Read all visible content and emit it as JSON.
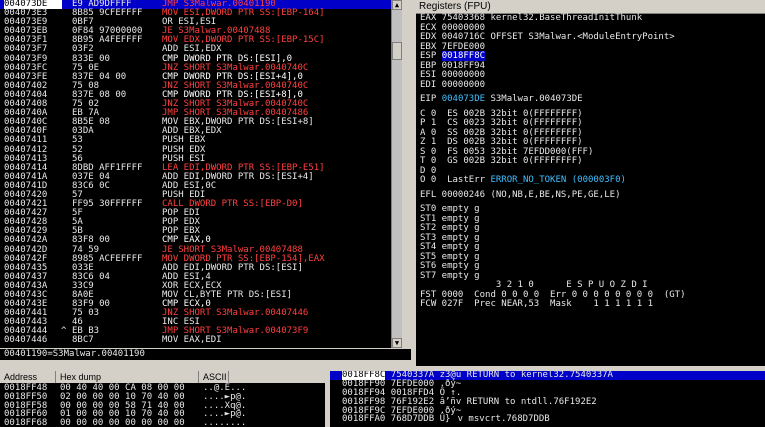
{
  "disasm": [
    {
      "addr": "004073DE",
      "mark": "",
      "hex": "E9 AD9DFFFF",
      "asm": "JMP S3Malwar.00401190",
      "cls": "op-jmp",
      "sel": true
    },
    {
      "addr": "004073E3",
      "mark": "",
      "hex": "8B85 9CFEFFFF",
      "asm": "MOV ESI,DWORD PTR SS:[EBP-164]",
      "cls": "op-jmp"
    },
    {
      "addr": "004073E9",
      "mark": "",
      "hex": "0BF7",
      "asm": "OR ESI,ESI",
      "cls": "op-normal"
    },
    {
      "addr": "004073EB",
      "mark": "",
      "hex": "0F84 97000000",
      "asm": "JE S3Malwar.00407488",
      "cls": "op-jmp"
    },
    {
      "addr": "004073F1",
      "mark": "",
      "hex": "8B95 A4FEFFFF",
      "asm": "MOV EDX,DWORD PTR SS:[EBP-15C]",
      "cls": "op-jmp"
    },
    {
      "addr": "004073F7",
      "mark": "",
      "hex": "03F2",
      "asm": "ADD ESI,EDX",
      "cls": "op-normal"
    },
    {
      "addr": "004073F9",
      "mark": "",
      "hex": "833E 00",
      "asm": "CMP DWORD PTR DS:[ESI],0",
      "cls": "op-cmp"
    },
    {
      "addr": "004073FC",
      "mark": "",
      "hex": "75 0E",
      "asm": "JNZ SHORT S3Malwar.0040740C",
      "cls": "op-jmp"
    },
    {
      "addr": "004073FE",
      "mark": "",
      "hex": "837E 04 00",
      "asm": "CMP DWORD PTR DS:[ESI+4],0",
      "cls": "op-cmp"
    },
    {
      "addr": "00407402",
      "mark": "",
      "hex": "75 08",
      "asm": "JNZ SHORT S3Malwar.0040740C",
      "cls": "op-jmp"
    },
    {
      "addr": "00407404",
      "mark": "",
      "hex": "837E 08 00",
      "asm": "CMP DWORD PTR DS:[ESI+8],0",
      "cls": "op-cmp"
    },
    {
      "addr": "00407408",
      "mark": "",
      "hex": "75 02",
      "asm": "JNZ SHORT S3Malwar.0040740C",
      "cls": "op-jmp"
    },
    {
      "addr": "0040740A",
      "mark": "",
      "hex": "EB 7A",
      "asm": "JMP SHORT S3Malwar.00407486",
      "cls": "op-jmp"
    },
    {
      "addr": "0040740C",
      "mark": "",
      "hex": "8B5E 08",
      "asm": "MOV EBX,DWORD PTR DS:[ESI+8]",
      "cls": "op-normal"
    },
    {
      "addr": "0040740F",
      "mark": "",
      "hex": "03DA",
      "asm": "ADD EBX,EDX",
      "cls": "op-normal"
    },
    {
      "addr": "00407411",
      "mark": "",
      "hex": "53",
      "asm": "PUSH EBX",
      "cls": "op-normal"
    },
    {
      "addr": "00407412",
      "mark": "",
      "hex": "52",
      "asm": "PUSH EDX",
      "cls": "op-normal"
    },
    {
      "addr": "00407413",
      "mark": "",
      "hex": "56",
      "asm": "PUSH ESI",
      "cls": "op-normal"
    },
    {
      "addr": "00407414",
      "mark": "",
      "hex": "8DBD AFF1FFFF",
      "asm": "LEA EDI,DWORD PTR SS:[EBP-E51]",
      "cls": "op-jmp"
    },
    {
      "addr": "0040741A",
      "mark": "",
      "hex": "037E 04",
      "asm": "ADD EDI,DWORD PTR DS:[ESI+4]",
      "cls": "op-normal"
    },
    {
      "addr": "0040741D",
      "mark": "",
      "hex": "83C6 0C",
      "asm": "ADD ESI,0C",
      "cls": "op-normal"
    },
    {
      "addr": "00407420",
      "mark": "",
      "hex": "57",
      "asm": "PUSH EDI",
      "cls": "op-normal"
    },
    {
      "addr": "00407421",
      "mark": "",
      "hex": "FF95 30FFFFFF",
      "asm": "CALL DWORD PTR SS:[EBP-D0]",
      "cls": "op-jmp"
    },
    {
      "addr": "00407427",
      "mark": "",
      "hex": "5F",
      "asm": "POP EDI",
      "cls": "op-normal"
    },
    {
      "addr": "00407428",
      "mark": "",
      "hex": "5A",
      "asm": "POP EDX",
      "cls": "op-normal"
    },
    {
      "addr": "00407429",
      "mark": "",
      "hex": "5B",
      "asm": "POP EBX",
      "cls": "op-normal"
    },
    {
      "addr": "0040742A",
      "mark": "",
      "hex": "83F8 00",
      "asm": "CMP EAX,0",
      "cls": "op-cmp"
    },
    {
      "addr": "0040742D",
      "mark": "",
      "hex": "74 59",
      "asm": "JE SHORT S3Malwar.00407488",
      "cls": "op-jmp"
    },
    {
      "addr": "0040742F",
      "mark": "",
      "hex": "8985 ACFEFFFF",
      "asm": "MOV DWORD PTR SS:[EBP-154],EAX",
      "cls": "op-jmp"
    },
    {
      "addr": "00407435",
      "mark": "",
      "hex": "033E",
      "asm": "ADD EDI,DWORD PTR DS:[ESI]",
      "cls": "op-normal"
    },
    {
      "addr": "00407437",
      "mark": "",
      "hex": "83C6 04",
      "asm": "ADD ESI,4",
      "cls": "op-normal"
    },
    {
      "addr": "0040743A",
      "mark": "",
      "hex": "33C9",
      "asm": "XOR ECX,ECX",
      "cls": "op-normal"
    },
    {
      "addr": "0040743C",
      "mark": "",
      "hex": "8A0E",
      "asm": "MOV CL,BYTE PTR DS:[ESI]",
      "cls": "op-normal"
    },
    {
      "addr": "0040743E",
      "mark": "",
      "hex": "83F9 00",
      "asm": "CMP ECX,0",
      "cls": "op-cmp"
    },
    {
      "addr": "00407441",
      "mark": "",
      "hex": "75 03",
      "asm": "JNZ SHORT S3Malwar.00407446",
      "cls": "op-jmp"
    },
    {
      "addr": "00407443",
      "mark": "",
      "hex": "46",
      "asm": "INC ESI",
      "cls": "op-normal"
    },
    {
      "addr": "00407444",
      "mark": "^",
      "hex": "EB B3",
      "asm": "JMP SHORT S3Malwar.004073F9",
      "cls": "op-jmp"
    },
    {
      "addr": "00407446",
      "mark": "",
      "hex": "8BC7",
      "asm": "MOV EAX,EDI",
      "cls": "op-normal"
    }
  ],
  "info_line": "00401190=S3Malwar.00401190",
  "registers": {
    "title": "Registers (FPU)",
    "lines": [
      "EAX 75403368 kernel32.BaseThreadInitThunk",
      "ECX 00000000",
      "EDX 0040716C OFFSET S3Malwar.<ModuleEntryPoint>",
      "EBX 7EFDE000",
      "ESP 0018FF8C",
      "EBP 0018FF94",
      "ESI 00000000",
      "EDI 00000000",
      "",
      "EIP 004073DE S3Malwar.004073DE",
      "",
      "C 0  ES 002B 32bit 0(FFFFFFFF)",
      "P 1  CS 0023 32bit 0(FFFFFFFF)",
      "A 0  SS 002B 32bit 0(FFFFFFFF)",
      "Z 1  DS 002B 32bit 0(FFFFFFFF)",
      "S 0  FS 0053 32bit 7EFDD000(FFF)",
      "T 0  GS 002B 32bit 0(FFFFFFFF)",
      "D 0",
      "O 0  LastErr ERROR_NO_TOKEN (000003F0)",
      "",
      "EFL 00000246 (NO,NB,E,BE,NS,PE,GE,LE)",
      "",
      "ST0 empty g",
      "ST1 empty g",
      "ST2 empty g",
      "ST3 empty g",
      "ST4 empty g",
      "ST5 empty g",
      "ST6 empty g",
      "ST7 empty g",
      "              3 2 1 0      E S P U O Z D I",
      "FST 0000  Cond 0 0 0 0  Err 0 0 0 0 0 0 0 0  (GT)",
      "FCW 027F  Prec NEAR,53  Mask    1 1 1 1 1 1"
    ]
  },
  "dump": {
    "headers": {
      "address": "Address",
      "hex": "Hex dump",
      "ascii": "ASCII"
    },
    "rows": [
      {
        "addr": "0018FF48",
        "hex": "00 40 40 00 CA 08 00 00",
        "ascii": "..@.Ê..."
      },
      {
        "addr": "0018FF50",
        "hex": "02 00 00 00 10 70 40 00",
        "ascii": "....►p@."
      },
      {
        "addr": "0018FF58",
        "hex": "00 00 00 00 58 71 40 00",
        "ascii": "....Xq@."
      },
      {
        "addr": "0018FF60",
        "hex": "01 00 00 00 10 70 40 00",
        "ascii": "....►p@."
      },
      {
        "addr": "0018FF68",
        "hex": "00 00 00 00 00 00 00 00",
        "ascii": "........"
      }
    ]
  },
  "stack": [
    {
      "addr": "0018FF8C",
      "val": "7540337A",
      "comment": "z3@u RETURN to kernel32.7540337A"
    },
    {
      "addr": "0018FF90",
      "val": "7EFDE000",
      "comment": ".ðý~"
    },
    {
      "addr": "0018FF94",
      "val": "0018FFD4",
      "comment": "Ô ↑."
    },
    {
      "addr": "0018FF98",
      "val": "76F192E2",
      "comment": "â’ñv RETURN to ntdll.76F192E2"
    },
    {
      "addr": "0018FF9C",
      "val": "7EFDE000",
      "comment": ".ðý~"
    },
    {
      "addr": "0018FFA0",
      "val": "768D7DDB",
      "comment": "Û}v msvcrt.768D7DDB"
    }
  ]
}
